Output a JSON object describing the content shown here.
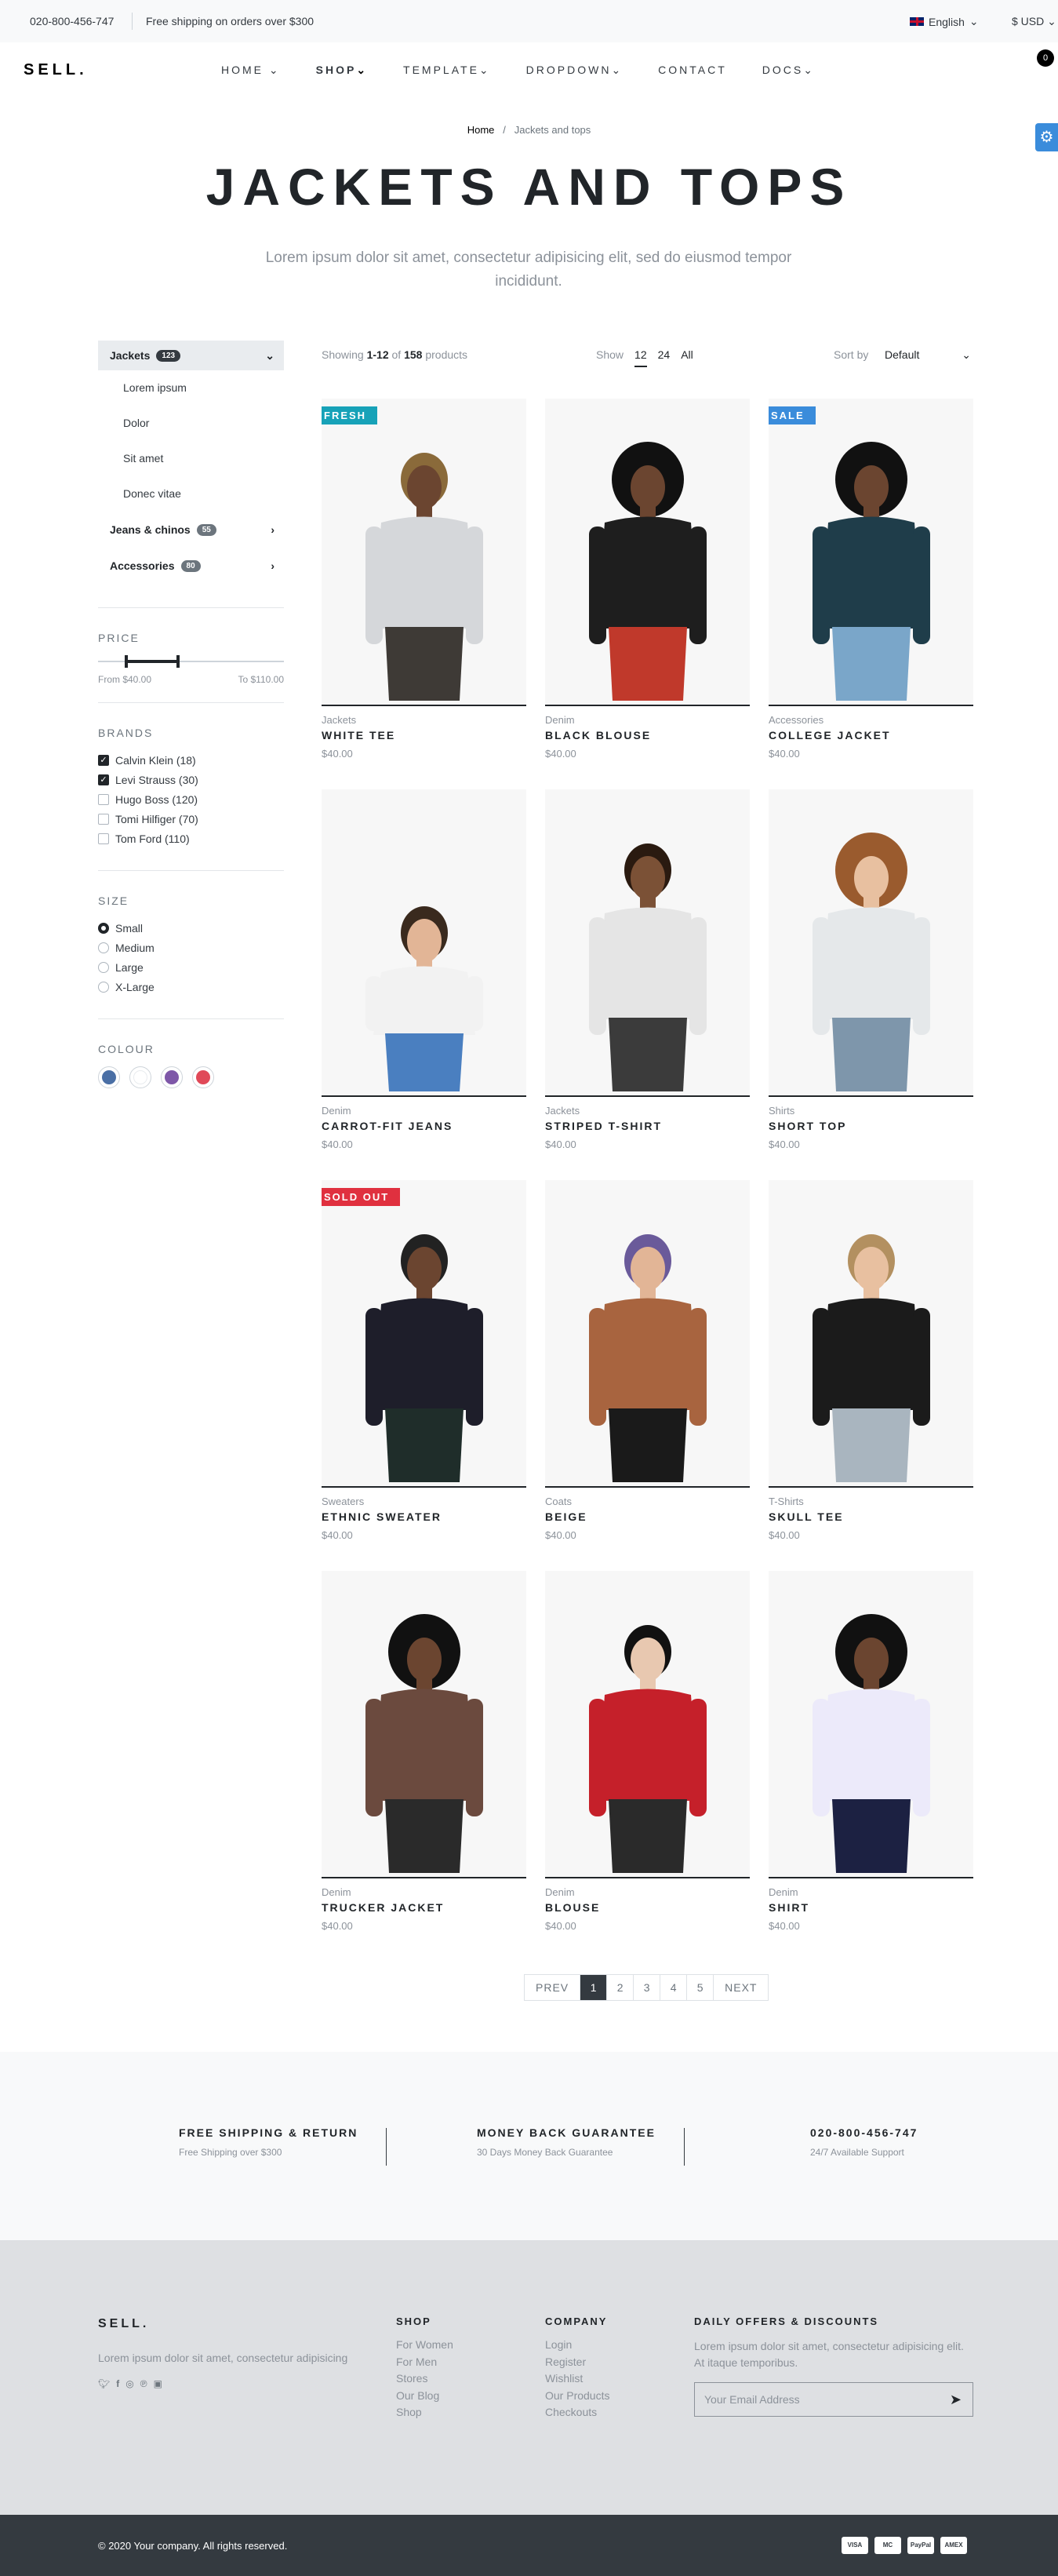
{
  "topbar": {
    "phone": "020-800-456-747",
    "shipping": "Free shipping on orders over $300",
    "language": "English",
    "currency": "$ USD"
  },
  "nav": {
    "logo": "SELL.",
    "items": [
      "HOME",
      "SHOP",
      "TEMPLATE",
      "DROPDOWN",
      "CONTACT",
      "DOCS"
    ],
    "cart_count": "0"
  },
  "breadcrumb": {
    "home": "Home",
    "current": "Jackets and tops"
  },
  "hero": {
    "title": "JACKETS AND TOPS",
    "lead": "Lorem ipsum dolor sit amet, consectetur adipisicing elit, sed do eiusmod tempor incididunt."
  },
  "sidebar": {
    "categories": [
      {
        "label": "Jackets",
        "count": "123"
      },
      {
        "label": "Jeans & chinos",
        "count": "55"
      },
      {
        "label": "Accessories",
        "count": "80"
      }
    ],
    "subcategories": [
      "Lorem ipsum",
      "Dolor",
      "Sit amet",
      "Donec vitae"
    ],
    "price": {
      "title": "PRICE",
      "from": "From $40.00",
      "to": "To $110.00",
      "min_fraction": 0.15,
      "max_fraction": 0.43
    },
    "brands": {
      "title": "BRANDS",
      "items": [
        {
          "label": "Calvin Klein (18)",
          "checked": true
        },
        {
          "label": "Levi Strauss (30)",
          "checked": true
        },
        {
          "label": "Hugo Boss (120)",
          "checked": false
        },
        {
          "label": "Tomi Hilfiger (70)",
          "checked": false
        },
        {
          "label": "Tom Ford (110)",
          "checked": false
        }
      ]
    },
    "size": {
      "title": "SIZE",
      "items": [
        "Small",
        "Medium",
        "Large",
        "X-Large"
      ],
      "selected": "Small"
    },
    "colour": {
      "title": "COLOUR",
      "items": [
        "#4a6fa5",
        "#ffffff",
        "#7e57a8",
        "#e04958"
      ]
    }
  },
  "toolbar": {
    "showing_prefix": "Showing ",
    "range": "1-12",
    "of": " of ",
    "total": "158",
    "suffix": " products",
    "show_label": "Show",
    "show_options": [
      "12",
      "24",
      "All"
    ],
    "sort_label": "Sort by",
    "sort_value": "Default"
  },
  "products": [
    {
      "category": "Jackets",
      "name": "WHITE TEE",
      "price": "$40.00",
      "badge": "FRESH",
      "badge_color": "#17a2b8",
      "figure": "tee"
    },
    {
      "category": "Denim",
      "name": "BLACK BLOUSE",
      "price": "$40.00",
      "badge": "",
      "badge_color": "",
      "figure": "blouse"
    },
    {
      "category": "Accessories",
      "name": "COLLEGE JACKET",
      "price": "$40.00",
      "badge": "SALE",
      "badge_color": "#3a8cdb",
      "figure": "college"
    },
    {
      "category": "Denim",
      "name": "CARROT-FIT JEANS",
      "price": "$40.00",
      "badge": "",
      "badge_color": "",
      "figure": "jeans"
    },
    {
      "category": "Jackets",
      "name": "STRIPED T-SHIRT",
      "price": "$40.00",
      "badge": "",
      "badge_color": "",
      "figure": "couple"
    },
    {
      "category": "Shirts",
      "name": "SHORT TOP",
      "price": "$40.00",
      "badge": "",
      "badge_color": "",
      "figure": "shorttop"
    },
    {
      "category": "Sweaters",
      "name": "ETHNIC SWEATER",
      "price": "$40.00",
      "badge": "SOLD OUT",
      "badge_color": "#e0303f",
      "figure": "sweater"
    },
    {
      "category": "Coats",
      "name": "BEIGE",
      "price": "$40.00",
      "badge": "",
      "badge_color": "",
      "figure": "coat"
    },
    {
      "category": "T-Shirts",
      "name": "SKULL TEE",
      "price": "$40.00",
      "badge": "",
      "badge_color": "",
      "figure": "skull"
    },
    {
      "category": "Denim",
      "name": "TRUCKER JACKET",
      "price": "$40.00",
      "badge": "",
      "badge_color": "",
      "figure": "trucker"
    },
    {
      "category": "Denim",
      "name": "BLOUSE",
      "price": "$40.00",
      "badge": "",
      "badge_color": "",
      "figure": "redblouse"
    },
    {
      "category": "Denim",
      "name": "SHIRT",
      "price": "$40.00",
      "badge": "",
      "badge_color": "",
      "figure": "shirt"
    }
  ],
  "pagination": {
    "prev": "PREV",
    "pages": [
      "1",
      "2",
      "3",
      "4",
      "5"
    ],
    "current": "1",
    "next": "NEXT"
  },
  "features": [
    {
      "title": "FREE SHIPPING & RETURN",
      "sub": "Free Shipping over $300"
    },
    {
      "title": "MONEY BACK GUARANTEE",
      "sub": "30 Days Money Back Guarantee"
    },
    {
      "title": "020-800-456-747",
      "sub": "24/7 Available Support"
    }
  ],
  "footer": {
    "logo": "SELL.",
    "desc": "Lorem ipsum dolor sit amet, consectetur adipisicing",
    "social": [
      "twitter-icon",
      "facebook-icon",
      "instagram-icon",
      "pinterest-icon",
      "vimeo-icon"
    ],
    "shop": {
      "title": "SHOP",
      "links": [
        "For Women",
        "For Men",
        "Stores",
        "Our Blog",
        "Shop"
      ]
    },
    "company": {
      "title": "COMPANY",
      "links": [
        "Login",
        "Register",
        "Wishlist",
        "Our Products",
        "Checkouts"
      ]
    },
    "newsletter": {
      "title": "DAILY OFFERS & DISCOUNTS",
      "desc": "Lorem ipsum dolor sit amet, consectetur adipisicing elit. At itaque temporibus.",
      "placeholder": "Your Email Address"
    },
    "copyright": "© 2020 Your company. All rights reserved.",
    "payments": [
      "VISA",
      "MC",
      "PayPal",
      "AMEX"
    ]
  }
}
